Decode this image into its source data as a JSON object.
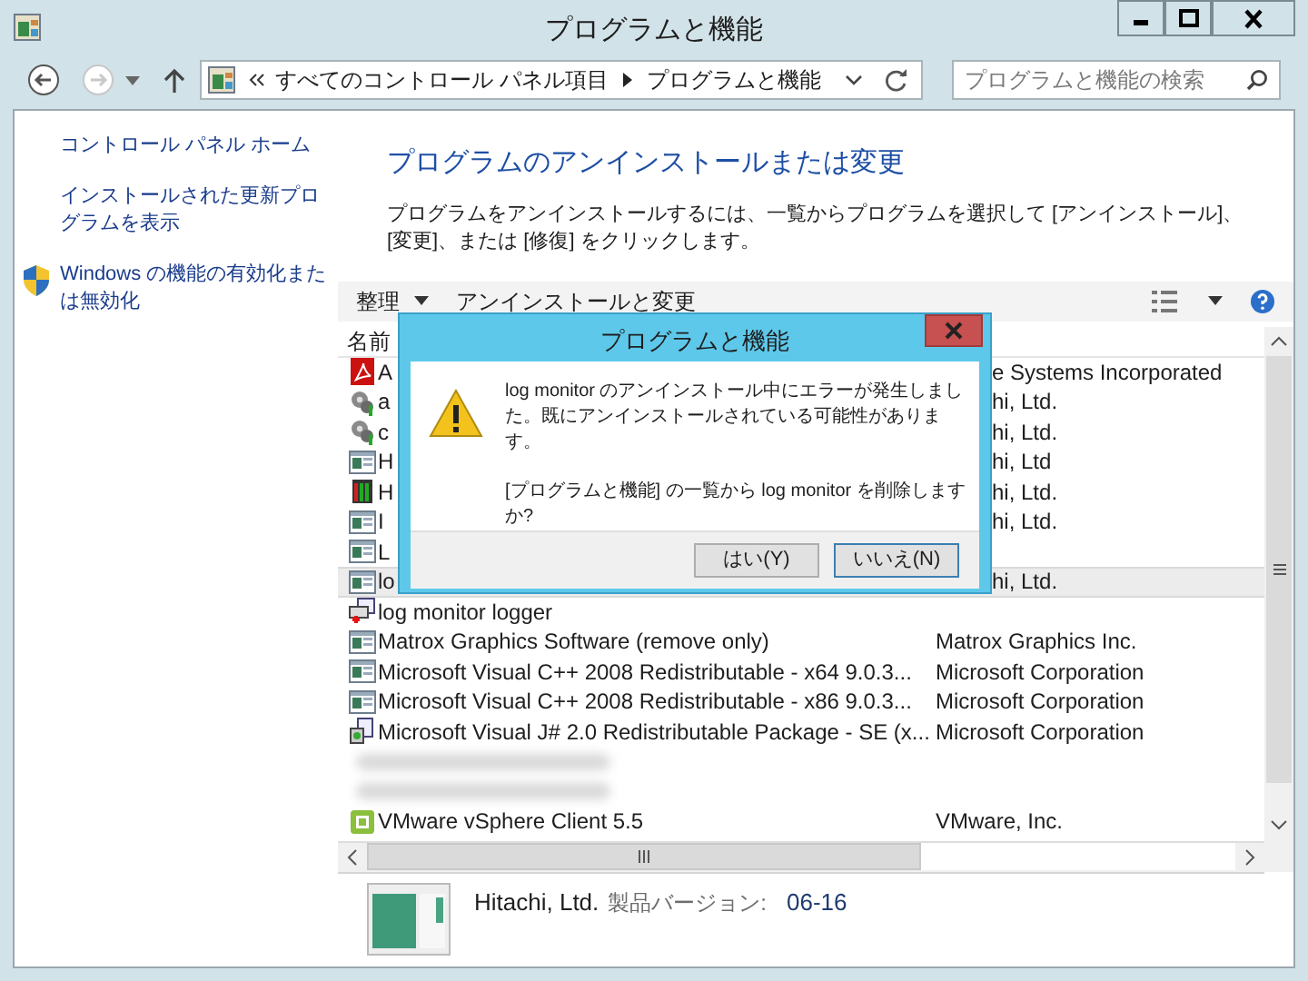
{
  "window": {
    "title": "プログラムと機能"
  },
  "address_bar": {
    "path": [
      "すべてのコントロール パネル項目",
      "プログラムと機能"
    ]
  },
  "search": {
    "placeholder": "プログラムと機能の検索"
  },
  "sidebar": {
    "items": [
      {
        "label": "コントロール パネル ホーム",
        "kind": "link"
      },
      {
        "label": "インストールされた更新プログラムを表示",
        "kind": "link"
      },
      {
        "label": "Windows の機能の有効化または無効化",
        "kind": "shield"
      }
    ]
  },
  "main": {
    "heading": "プログラムのアンインストールまたは変更",
    "description": "プログラムをアンインストールするには、一覧からプログラムを選択して [アンインストール]、[変更]、または [修復] をクリックします。"
  },
  "toolbar": {
    "items": [
      {
        "label": "整理",
        "kind": "menu"
      },
      {
        "label": "アンインストールと変更",
        "kind": "action"
      }
    ]
  },
  "table": {
    "columns": [
      "名前"
    ],
    "rows": [
      {
        "kind": "pdf",
        "name": "A",
        "publisher": "e Systems Incorporated",
        "cut": true,
        "selected": false
      },
      {
        "kind": "gears",
        "name": "a",
        "publisher": "hi, Ltd.",
        "cut": true,
        "selected": false
      },
      {
        "kind": "gears",
        "name": "c",
        "publisher": "hi, Ltd.",
        "cut": true,
        "selected": false
      },
      {
        "kind": "window",
        "name": "H",
        "publisher": "hi, Ltd",
        "cut": true,
        "selected": false
      },
      {
        "kind": "server",
        "name": "H",
        "publisher": "hi, Ltd.",
        "cut": true,
        "selected": false
      },
      {
        "kind": "window",
        "name": "I",
        "publisher": "hi, Ltd.",
        "cut": true,
        "selected": false
      },
      {
        "kind": "window",
        "name": "L",
        "selected": false
      },
      {
        "kind": "window",
        "name": "lo",
        "publisher": "hi, Ltd.",
        "cut": true,
        "selected": true
      },
      {
        "kind": "installer",
        "name": "log monitor logger",
        "selected": false
      },
      {
        "kind": "window",
        "name": "Matrox Graphics Software (remove only)",
        "publisher": "Matrox Graphics Inc.",
        "selected": false
      },
      {
        "kind": "window",
        "name": "Microsoft Visual C++ 2008 Redistributable - x64 9.0.3...",
        "publisher": "Microsoft Corporation",
        "selected": false
      },
      {
        "kind": "window",
        "name": "Microsoft Visual C++ 2008 Redistributable - x86 9.0.3...",
        "publisher": "Microsoft Corporation",
        "selected": false
      },
      {
        "kind": "setup",
        "name": "Microsoft Visual J# 2.0 Redistributable Package - SE (x...",
        "publisher": "Microsoft Corporation",
        "selected": false
      },
      {
        "kind": "redacted",
        "selected": false
      },
      {
        "kind": "redacted",
        "selected": false
      },
      {
        "kind": "vmware",
        "name": "VMware vSphere Client 5.5",
        "publisher": "VMware, Inc.",
        "selected": false
      }
    ]
  },
  "details": {
    "publisher": "Hitachi, Ltd.",
    "version_label": "製品バージョン:",
    "version": "06-16"
  },
  "dialog": {
    "title": "プログラムと機能",
    "message": "log monitor のアンインストール中にエラーが発生しました。既にアンインストールされている可能性があります。",
    "question": "[プログラムと機能] の一覧から log monitor を削除しますか?",
    "buttons": [
      {
        "label": "はい(Y)",
        "default": false
      },
      {
        "label": "いいえ(N)",
        "default": true
      }
    ]
  }
}
